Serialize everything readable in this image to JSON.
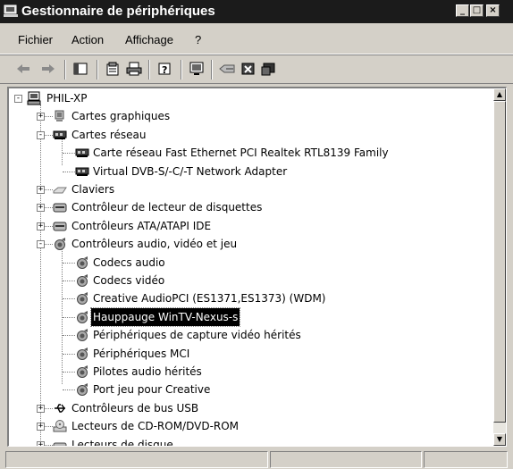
{
  "window": {
    "title": "Gestionnaire de périphériques",
    "minimize": "_",
    "maximize": "□",
    "close": "×"
  },
  "menu": [
    "Fichier",
    "Action",
    "Affichage",
    "?"
  ],
  "tree": {
    "root": "PHIL-XP",
    "items": [
      {
        "label": "Cartes graphiques",
        "icon": "display-adapter-icon"
      },
      {
        "label": "Cartes réseau",
        "icon": "network-card-icon"
      },
      {
        "label": "Carte réseau Fast Ethernet PCI Realtek RTL8139 Family",
        "icon": "network-card-icon"
      },
      {
        "label": "Virtual DVB-S/-C/-T Network Adapter",
        "icon": "network-card-icon"
      },
      {
        "label": "Claviers",
        "icon": "keyboard-icon"
      },
      {
        "label": "Contrôleur de lecteur de disquettes",
        "icon": "floppy-controller-icon"
      },
      {
        "label": "Contrôleurs ATA/ATAPI IDE",
        "icon": "ide-controller-icon"
      },
      {
        "label": "Contrôleurs audio, vidéo et jeu",
        "icon": "sound-device-icon"
      },
      {
        "label": "Codecs audio",
        "icon": "sound-device-icon"
      },
      {
        "label": "Codecs vidéo",
        "icon": "sound-device-icon"
      },
      {
        "label": "Creative AudioPCI (ES1371,ES1373) (WDM)",
        "icon": "sound-device-icon"
      },
      {
        "label": "Hauppauge WinTV-Nexus-s",
        "icon": "sound-device-icon"
      },
      {
        "label": "Périphériques de capture vidéo hérités",
        "icon": "sound-device-icon"
      },
      {
        "label": "Périphériques MCI",
        "icon": "sound-device-icon"
      },
      {
        "label": "Pilotes audio hérités",
        "icon": "sound-device-icon"
      },
      {
        "label": "Port jeu pour Creative",
        "icon": "sound-device-icon"
      },
      {
        "label": "Contrôleurs de bus USB",
        "icon": "usb-icon"
      },
      {
        "label": "Lecteurs de CD-ROM/DVD-ROM",
        "icon": "cdrom-icon"
      },
      {
        "label": "Lecteurs de disque",
        "icon": "disk-drive-icon"
      }
    ]
  }
}
